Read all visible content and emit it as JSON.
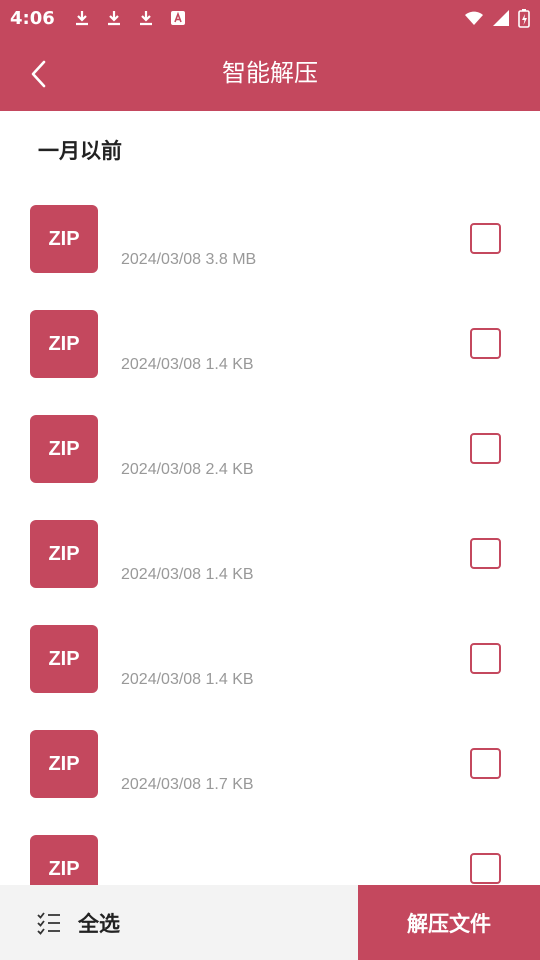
{
  "status_bar": {
    "time": "4:06",
    "left_icons": [
      "download-icon",
      "download-icon",
      "download-icon",
      "font-icon"
    ],
    "right_icons": [
      "wifi-icon",
      "signal-icon",
      "battery-charging-icon"
    ]
  },
  "app_bar": {
    "back_icon": "chevron-left-icon",
    "title": "智能解压"
  },
  "section": {
    "title": "一月以前"
  },
  "files": [
    {
      "badge": "ZIP",
      "meta": "2024/03/08 3.8 MB",
      "checked": false
    },
    {
      "badge": "ZIP",
      "meta": "2024/03/08 1.4 KB",
      "checked": false
    },
    {
      "badge": "ZIP",
      "meta": "2024/03/08 2.4 KB",
      "checked": false
    },
    {
      "badge": "ZIP",
      "meta": "2024/03/08 1.4 KB",
      "checked": false
    },
    {
      "badge": "ZIP",
      "meta": "2024/03/08 1.4 KB",
      "checked": false
    },
    {
      "badge": "ZIP",
      "meta": "2024/03/08 1.7 KB",
      "checked": false
    },
    {
      "badge": "ZIP",
      "meta": "",
      "checked": false
    }
  ],
  "bottom_bar": {
    "select_all_icon": "checklist-icon",
    "select_all_label": "全选",
    "extract_label": "解压文件"
  },
  "colors": {
    "accent": "#c4485e",
    "bottom_left_bg": "#f3f3f3",
    "meta_text": "#999999"
  }
}
